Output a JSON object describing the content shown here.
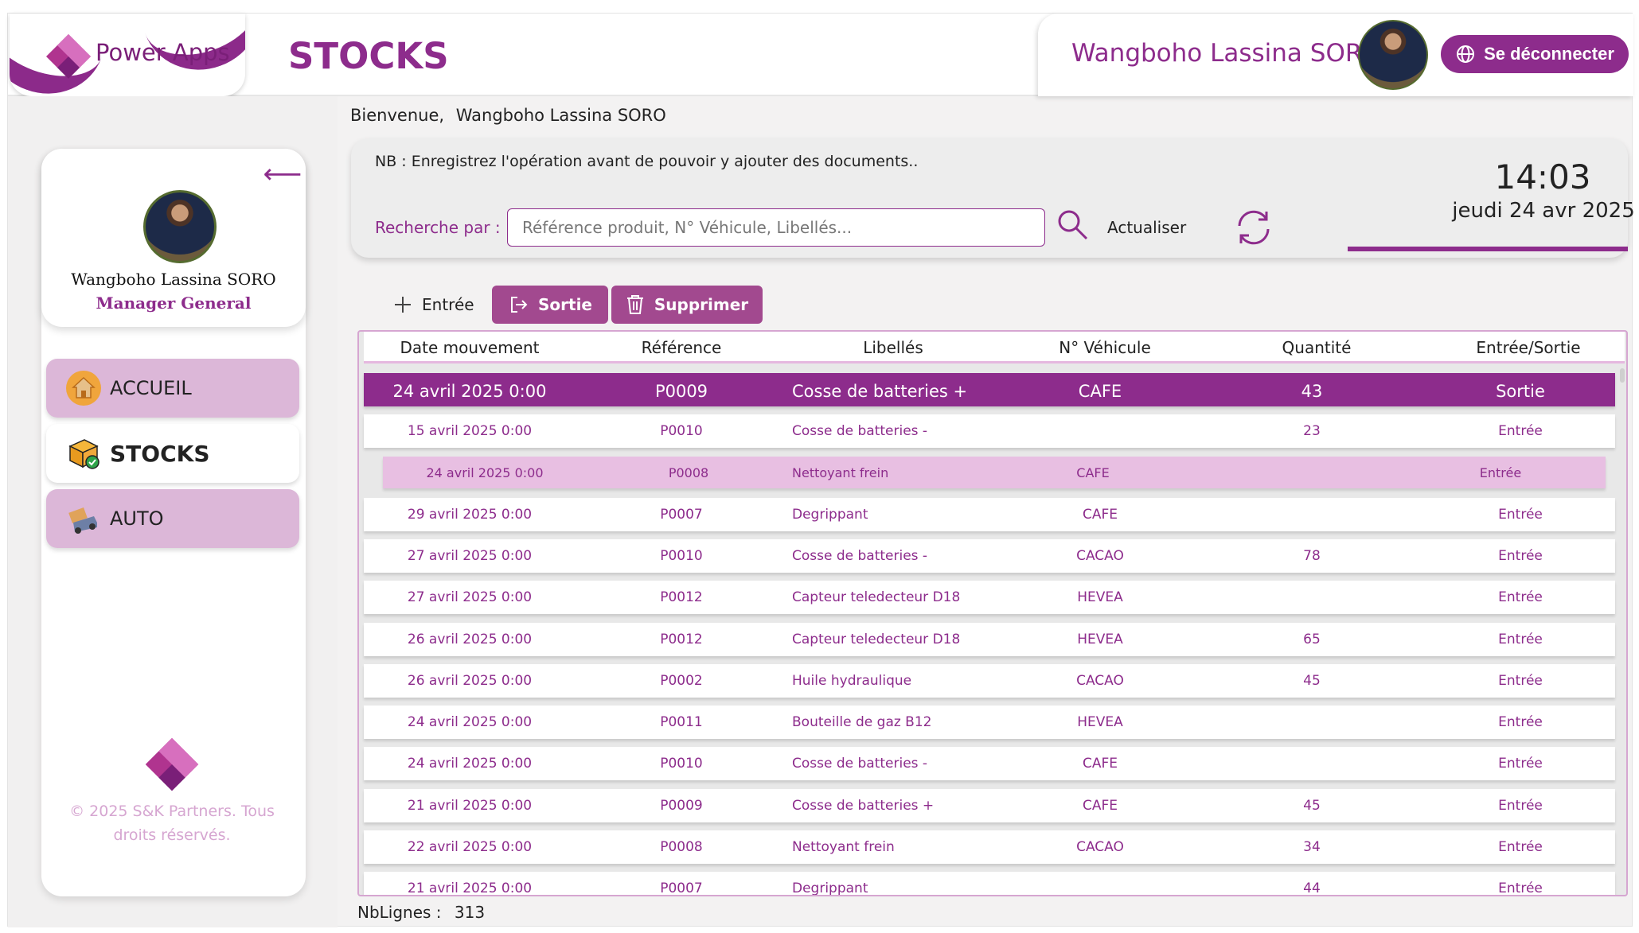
{
  "header": {
    "app_name": "Power Apps",
    "page_title": "STOCKS",
    "user_name": "Wangboho Lassina SORO",
    "logout_label": "Se déconnecter"
  },
  "welcome": {
    "label": "Bienvenue,",
    "name": "Wangboho Lassina SORO"
  },
  "sidebar": {
    "profile_name": "Wangboho Lassina SORO",
    "profile_role": "Manager General",
    "back_arrow": "⟵",
    "items": [
      {
        "label": "ACCUEIL",
        "icon": "home-icon"
      },
      {
        "label": "STOCKS",
        "icon": "stock-box-icon"
      },
      {
        "label": "AUTO",
        "icon": "truck-icon"
      }
    ],
    "copyright": "© 2025 S&K Partners. Tous droits réservés."
  },
  "info": {
    "note": "NB : Enregistrez l'opération avant de pouvoir y ajouter des documents..",
    "search_label": "Recherche par :",
    "search_placeholder": "Référence produit, N° Véhicule, Libellés...",
    "refresh_label": "Actualiser",
    "time": "14:03",
    "date": "jeudi 24 avr 2025"
  },
  "toolbar": {
    "entree": "Entrée",
    "sortie": "Sortie",
    "supprimer": "Supprimer"
  },
  "table": {
    "columns": [
      "Date mouvement",
      "Référence",
      "Libellés",
      "N° Véhicule",
      "Quantité",
      "Entrée/Sortie"
    ],
    "rows": [
      {
        "date": "24 avril 2025 0:00",
        "ref": "P0009",
        "lib": "Cosse de batteries +",
        "veh": "CAFE",
        "qty": "43",
        "io": "Sortie"
      },
      {
        "date": "15 avril 2025 0:00",
        "ref": "P0010",
        "lib": "Cosse de batteries -",
        "veh": "",
        "qty": "23",
        "io": "Entrée"
      },
      {
        "date": "24 avril 2025 0:00",
        "ref": "P0008",
        "lib": "Nettoyant frein",
        "veh": "CAFE",
        "qty": "",
        "io": "Entrée"
      },
      {
        "date": "29 avril 2025 0:00",
        "ref": "P0007",
        "lib": "Degrippant",
        "veh": "CAFE",
        "qty": "",
        "io": "Entrée"
      },
      {
        "date": "27 avril 2025 0:00",
        "ref": "P0010",
        "lib": "Cosse de batteries -",
        "veh": "CACAO",
        "qty": "78",
        "io": "Entrée"
      },
      {
        "date": "27 avril 2025 0:00",
        "ref": "P0012",
        "lib": "Capteur teledecteur D18",
        "veh": "HEVEA",
        "qty": "",
        "io": "Entrée"
      },
      {
        "date": "26 avril 2025 0:00",
        "ref": "P0012",
        "lib": "Capteur teledecteur D18",
        "veh": "HEVEA",
        "qty": "65",
        "io": "Entrée"
      },
      {
        "date": "26 avril 2025 0:00",
        "ref": "P0002",
        "lib": "Huile hydraulique",
        "veh": "CACAO",
        "qty": "45",
        "io": "Entrée"
      },
      {
        "date": "24 avril 2025 0:00",
        "ref": "P0011",
        "lib": "Bouteille de gaz B12",
        "veh": "HEVEA",
        "qty": "",
        "io": "Entrée"
      },
      {
        "date": "24 avril 2025 0:00",
        "ref": "P0010",
        "lib": "Cosse de batteries -",
        "veh": "CAFE",
        "qty": "",
        "io": "Entrée"
      },
      {
        "date": "21 avril 2025 0:00",
        "ref": "P0009",
        "lib": "Cosse de batteries +",
        "veh": "CAFE",
        "qty": "45",
        "io": "Entrée"
      },
      {
        "date": "22 avril 2025 0:00",
        "ref": "P0008",
        "lib": "Nettoyant frein",
        "veh": "CACAO",
        "qty": "34",
        "io": "Entrée"
      },
      {
        "date": "21 avril 2025 0:00",
        "ref": "P0007",
        "lib": "Degrippant",
        "veh": "",
        "qty": "44",
        "io": "Entrée"
      }
    ]
  },
  "footer": {
    "nblignes_label": "NbLignes :",
    "nblignes_value": "313"
  },
  "colors": {
    "accent": "#8d2c8c",
    "nav_bg": "#dcb7d8",
    "hover_row": "#e8bfe2",
    "button": "#a2498f"
  }
}
